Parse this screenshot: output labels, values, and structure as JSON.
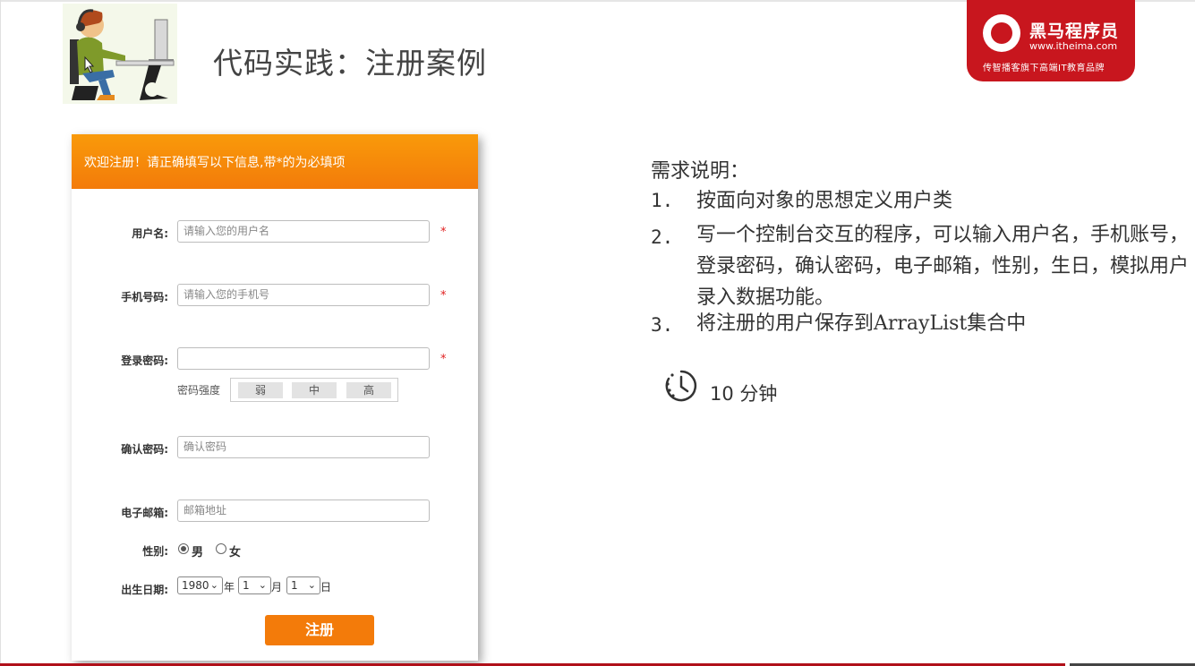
{
  "slide": {
    "title": "代码实践：注册案例"
  },
  "logo": {
    "name": "黑马程序员",
    "url": "www.itheima.com",
    "slogan": "传智播客旗下高端IT教育品牌"
  },
  "form": {
    "header": "欢迎注册！请正确填写以下信息,带*的为必填项",
    "required_mark": "*",
    "fields": [
      {
        "label": "用户名:",
        "placeholder": "请输入您的用户名"
      },
      {
        "label": "手机号码:",
        "placeholder": "请输入您的手机号"
      },
      {
        "label": "登录密码:",
        "placeholder": ""
      },
      {
        "label": "确认密码:",
        "placeholder": "确认密码"
      },
      {
        "label": "电子邮箱:",
        "placeholder": "邮箱地址"
      }
    ],
    "password_strength": {
      "label": "密码强度",
      "levels": [
        "弱",
        "中",
        "高"
      ]
    },
    "gender": {
      "label": "性别:",
      "options": [
        "男",
        "女"
      ],
      "selected": "男"
    },
    "birthday": {
      "label": "出生日期:",
      "year": "1980",
      "year_unit": "年",
      "month": "1",
      "month_unit": "月",
      "day": "1",
      "day_unit": "日"
    },
    "submit_label": "注册"
  },
  "requirements": {
    "title": "需求说明：",
    "items": [
      {
        "num": "1.",
        "text": "按面向对象的思想定义用户类"
      },
      {
        "num": "2.",
        "text": "写一个控制台交互的程序，可以输入用户名，手机账号，登录密码，确认密码，电子邮箱，性别，生日，模拟用户录入数据功能。"
      },
      {
        "num": "3.",
        "text": "将注册的用户保存到ArrayList集合中"
      }
    ]
  },
  "timer": {
    "icon": "timer-icon",
    "text": "10 分钟"
  }
}
